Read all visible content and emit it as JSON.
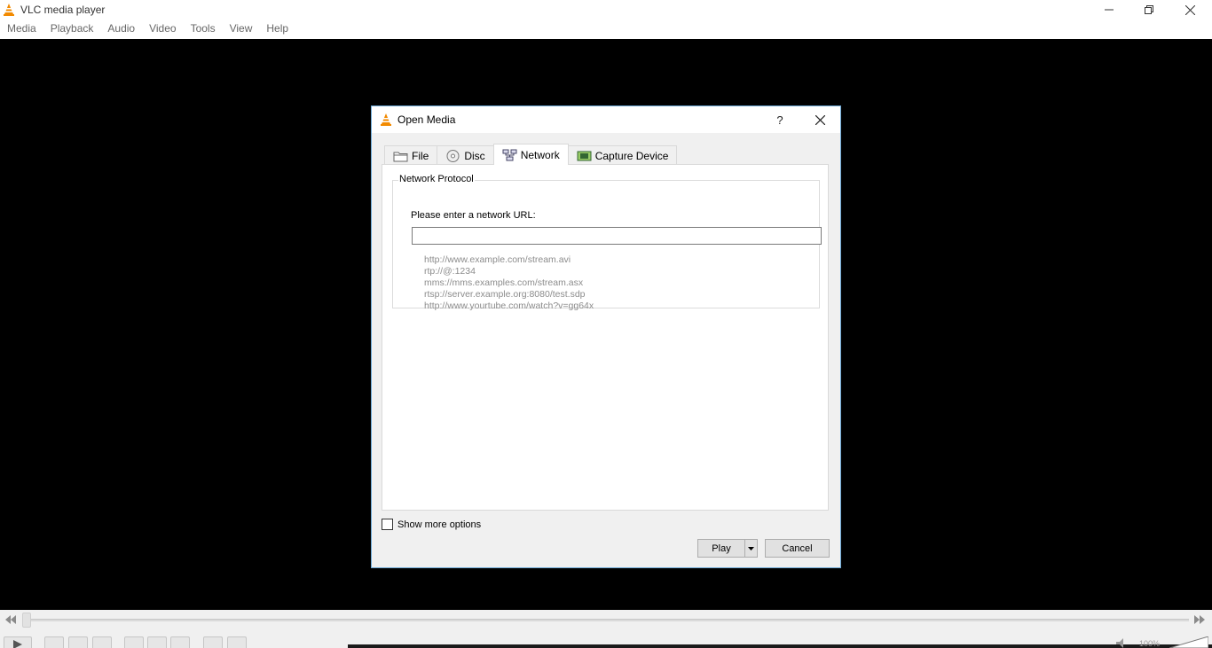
{
  "window": {
    "title": "VLC media player"
  },
  "menu": {
    "items": [
      "Media",
      "Playback",
      "Audio",
      "Video",
      "Tools",
      "View",
      "Help"
    ]
  },
  "dialog": {
    "title": "Open Media",
    "help_label": "?",
    "tabs": [
      {
        "label": "File",
        "icon": "folder-icon",
        "active": false
      },
      {
        "label": "Disc",
        "icon": "disc-icon",
        "active": false
      },
      {
        "label": "Network",
        "icon": "network-icon",
        "active": true
      },
      {
        "label": "Capture Device",
        "icon": "capture-device-icon",
        "active": false
      }
    ],
    "network": {
      "group_title": "Network Protocol",
      "url_label": "Please enter a network URL:",
      "url_value": "",
      "examples": [
        "http://www.example.com/stream.avi",
        "rtp://@:1234",
        "mms://mms.examples.com/stream.asx",
        "rtsp://server.example.org:8080/test.sdp",
        "http://www.yourtube.com/watch?v=gg64x"
      ]
    },
    "show_more_options": {
      "label": "Show more options",
      "checked": false
    },
    "buttons": {
      "play": "Play",
      "cancel": "Cancel"
    }
  },
  "controls": {
    "volume": "100%"
  },
  "colors": {
    "vlc_orange": "#f28a00",
    "video_bg": "#000000",
    "dialog_border": "#6ea9d6",
    "example_text": "#8c8c8c"
  }
}
